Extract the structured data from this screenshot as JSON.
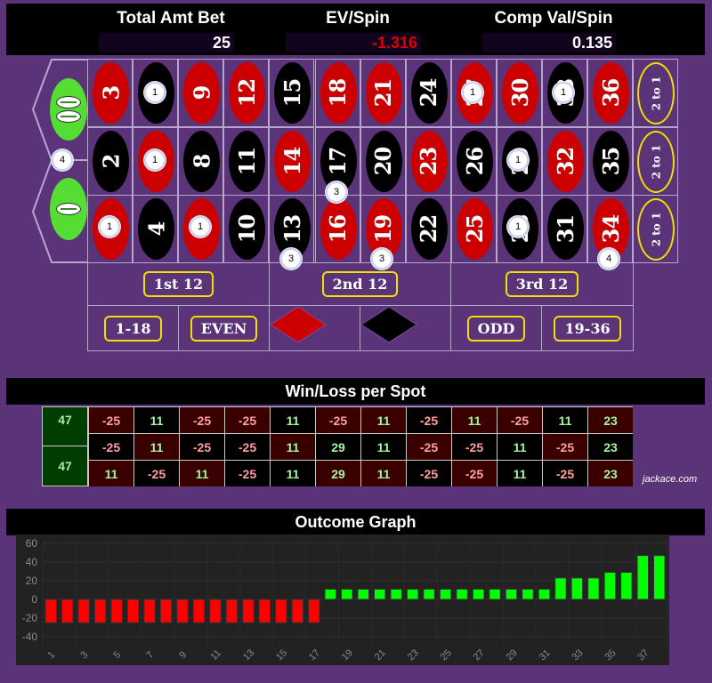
{
  "stats": {
    "total_amt_bet": {
      "label": "Total Amt Bet",
      "value": "25"
    },
    "ev_spin": {
      "label": "EV/Spin",
      "value": "-1.316"
    },
    "comp_val_spin": {
      "label": "Comp Val/Spin",
      "value": "0.135"
    }
  },
  "board": {
    "zeros": [
      {
        "label": "00"
      },
      {
        "label": "0"
      }
    ],
    "numbers": [
      {
        "n": "3",
        "color": "red"
      },
      {
        "n": "6",
        "color": "black"
      },
      {
        "n": "9",
        "color": "red"
      },
      {
        "n": "12",
        "color": "red"
      },
      {
        "n": "15",
        "color": "black"
      },
      {
        "n": "18",
        "color": "red"
      },
      {
        "n": "21",
        "color": "red"
      },
      {
        "n": "24",
        "color": "black"
      },
      {
        "n": "27",
        "color": "red"
      },
      {
        "n": "30",
        "color": "red"
      },
      {
        "n": "33",
        "color": "black"
      },
      {
        "n": "36",
        "color": "red"
      },
      {
        "n": "2",
        "color": "black"
      },
      {
        "n": "5",
        "color": "red"
      },
      {
        "n": "8",
        "color": "black"
      },
      {
        "n": "11",
        "color": "black"
      },
      {
        "n": "14",
        "color": "red"
      },
      {
        "n": "17",
        "color": "black"
      },
      {
        "n": "20",
        "color": "black"
      },
      {
        "n": "23",
        "color": "red"
      },
      {
        "n": "26",
        "color": "black"
      },
      {
        "n": "29",
        "color": "black"
      },
      {
        "n": "32",
        "color": "red"
      },
      {
        "n": "35",
        "color": "black"
      },
      {
        "n": "1",
        "color": "red"
      },
      {
        "n": "4",
        "color": "black"
      },
      {
        "n": "7",
        "color": "red"
      },
      {
        "n": "10",
        "color": "black"
      },
      {
        "n": "13",
        "color": "black"
      },
      {
        "n": "16",
        "color": "red"
      },
      {
        "n": "19",
        "color": "red"
      },
      {
        "n": "22",
        "color": "black"
      },
      {
        "n": "25",
        "color": "red"
      },
      {
        "n": "28",
        "color": "black"
      },
      {
        "n": "31",
        "color": "black"
      },
      {
        "n": "34",
        "color": "red"
      }
    ],
    "column_bets": [
      "2 to 1",
      "2 to 1",
      "2 to 1"
    ],
    "dozens": [
      "1st 12",
      "2nd 12",
      "3rd 12"
    ],
    "outside": [
      "1-18",
      "EVEN",
      "red-diamond",
      "black-diamond",
      "ODD",
      "19-36"
    ],
    "colors": {
      "red": "#cc0000",
      "black": "#000000",
      "green": "#55dd33",
      "felt": "#5b3379",
      "accent": "#f0e000"
    }
  },
  "chips": [
    {
      "value": "4",
      "spot": "0/00/2 basket"
    },
    {
      "value": "1",
      "spot": "6"
    },
    {
      "value": "1",
      "spot": "5"
    },
    {
      "value": "1",
      "spot": "1"
    },
    {
      "value": "1",
      "spot": "7"
    },
    {
      "value": "3",
      "spot": "16/17 split"
    },
    {
      "value": "3",
      "spot": "13-15 street"
    },
    {
      "value": "3",
      "spot": "19-21 street"
    },
    {
      "value": "1",
      "spot": "27"
    },
    {
      "value": "1",
      "spot": "33"
    },
    {
      "value": "1",
      "spot": "29"
    },
    {
      "value": "1",
      "spot": "28"
    },
    {
      "value": "4",
      "spot": "34-36 street"
    }
  ],
  "winloss": {
    "title": "Win/Loss per Spot",
    "zeros": [
      "47",
      "47"
    ],
    "rows": [
      [
        "-25",
        "11",
        "-25",
        "-25",
        "11",
        "-25",
        "11",
        "-25",
        "11",
        "-25",
        "11",
        "23"
      ],
      [
        "-25",
        "11",
        "-25",
        "-25",
        "11",
        "29",
        "11",
        "-25",
        "-25",
        "11",
        "-25",
        "23"
      ],
      [
        "11",
        "-25",
        "11",
        "-25",
        "11",
        "29",
        "11",
        "-25",
        "-25",
        "11",
        "-25",
        "23"
      ]
    ],
    "brand": "jackace.com"
  },
  "graph": {
    "title": "Outcome Graph"
  },
  "chart_data": {
    "type": "bar",
    "title": "Outcome Graph",
    "xlabel": "",
    "ylabel": "",
    "ylim": [
      -40,
      60
    ],
    "yticks": [
      60,
      40,
      20,
      0,
      -20,
      -40
    ],
    "xticks": [
      "1",
      "3",
      "5",
      "7",
      "9",
      "11",
      "13",
      "15",
      "17",
      "19",
      "21",
      "23",
      "25",
      "27",
      "29",
      "31",
      "33",
      "35",
      "37"
    ],
    "grid": true,
    "categories": [
      "1",
      "2",
      "3",
      "4",
      "5",
      "6",
      "7",
      "8",
      "9",
      "10",
      "11",
      "12",
      "13",
      "14",
      "15",
      "16",
      "17",
      "18",
      "19",
      "20",
      "21",
      "22",
      "23",
      "24",
      "25",
      "26",
      "27",
      "28",
      "29",
      "30",
      "31",
      "32",
      "33",
      "34",
      "35",
      "36",
      "37",
      "38"
    ],
    "values": [
      -25,
      -25,
      -25,
      -25,
      -25,
      -25,
      -25,
      -25,
      -25,
      -25,
      -25,
      -25,
      -25,
      -25,
      -25,
      -25,
      -25,
      11,
      11,
      11,
      11,
      11,
      11,
      11,
      11,
      11,
      11,
      11,
      11,
      11,
      11,
      23,
      23,
      23,
      29,
      29,
      47,
      47
    ],
    "colors": {
      "negative": "#ff0000",
      "positive": "#00ff00"
    }
  }
}
